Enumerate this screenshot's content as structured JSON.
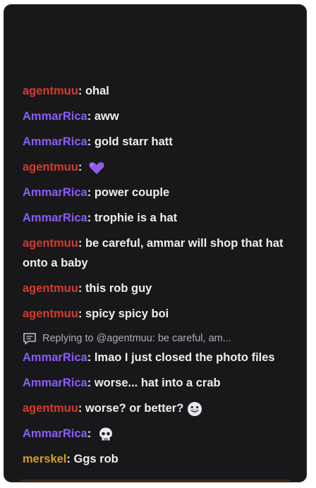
{
  "colors": {
    "background": "#18181b",
    "text": "#efeff1",
    "muted": "#adadb8",
    "ammar": "#8a5cf6",
    "agent": "#d63a2f",
    "merskel": "#d4a020"
  },
  "chat": {
    "messages": [
      {
        "user": "agentmuu",
        "color_key": "agent",
        "text": "ohal",
        "emote": null
      },
      {
        "user": "AmmarRica",
        "color_key": "ammar",
        "text": "aww",
        "emote": null
      },
      {
        "user": "AmmarRica",
        "color_key": "ammar",
        "text": "gold starr hatt",
        "emote": null
      },
      {
        "user": "agentmuu",
        "color_key": "agent",
        "text": "",
        "emote": "purple-heart-icon"
      },
      {
        "user": "AmmarRica",
        "color_key": "ammar",
        "text": "power couple",
        "emote": null
      },
      {
        "user": "AmmarRica",
        "color_key": "ammar",
        "text": "trophie is a hat",
        "emote": null
      },
      {
        "user": "agentmuu",
        "color_key": "agent",
        "text": "be careful, ammar will shop that hat onto a baby",
        "emote": null
      },
      {
        "user": "agentmuu",
        "color_key": "agent",
        "text": "this rob guy",
        "emote": null
      },
      {
        "user": "agentmuu",
        "color_key": "agent",
        "text": "spicy spicy boi",
        "emote": null
      },
      {
        "reply": "Replying to @agentmuu: be careful, am...",
        "user": "AmmarRica",
        "color_key": "ammar",
        "text": "lmao I just closed the photo files",
        "emote": null
      },
      {
        "user": "AmmarRica",
        "color_key": "ammar",
        "text": "worse... hat into a crab",
        "emote": null
      },
      {
        "user": "agentmuu",
        "color_key": "agent",
        "text": "worse? or better?",
        "emote": "grinning-face-icon"
      },
      {
        "user": "AmmarRica",
        "color_key": "ammar",
        "text": "",
        "emote": "skull-face-icon"
      },
      {
        "user": "merskel",
        "color_key": "merskel",
        "text": "Ggs rob",
        "emote": null
      }
    ]
  }
}
